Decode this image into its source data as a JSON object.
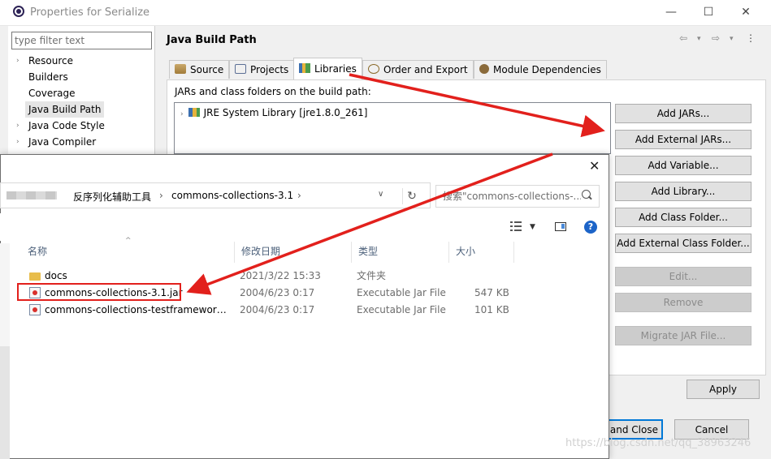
{
  "window": {
    "title": "Properties for Serialize",
    "minimize": "—",
    "maximize": "☐",
    "close": "✕"
  },
  "sidebar": {
    "filter_placeholder": "type filter text",
    "items": [
      {
        "label": "Resource",
        "arrow": "›"
      },
      {
        "label": "Builders",
        "arrow": ""
      },
      {
        "label": "Coverage",
        "arrow": ""
      },
      {
        "label": "Java Build Path",
        "arrow": ""
      },
      {
        "label": "Java Code Style",
        "arrow": "›"
      },
      {
        "label": "Java Compiler",
        "arrow": "›"
      }
    ]
  },
  "content": {
    "heading": "Java Build Path",
    "nav": {
      "back": "⇦",
      "back_drop": "▾",
      "fwd": "⇨",
      "fwd_drop": "▾",
      "menu": "⋮"
    },
    "tabs": [
      {
        "label": "Source"
      },
      {
        "label": "Projects"
      },
      {
        "label": "Libraries"
      },
      {
        "label": "Order and Export"
      },
      {
        "label": "Module Dependencies"
      }
    ],
    "panel_label": "JARs and class folders on the build path:",
    "library_entry": "JRE System Library [jre1.8.0_261]",
    "buttons": {
      "add_jars": "Add JARs...",
      "add_external_jars": "Add External JARs...",
      "add_variable": "Add Variable...",
      "add_library": "Add Library...",
      "add_class_folder": "Add Class Folder...",
      "add_external_class_folder": "Add External Class Folder...",
      "edit": "Edit...",
      "remove": "Remove",
      "migrate": "Migrate JAR File..."
    },
    "apply": "Apply",
    "apply_and_close": "and Close",
    "cancel": "Cancel"
  },
  "dialog": {
    "close": "✕",
    "breadcrumb": [
      "反序列化辅助工具",
      "commons-collections-3.1"
    ],
    "breadcrumb_sep": "›",
    "search_placeholder": "搜索\"commons-collections-...",
    "refresh": "↻",
    "columns": {
      "name": "名称",
      "modified": "修改日期",
      "type": "类型",
      "size": "大小"
    },
    "files": [
      {
        "name": "docs",
        "modified": "2021/3/22 15:33",
        "type": "文件夹",
        "size": "",
        "icon": "folder-icon"
      },
      {
        "name": "commons-collections-3.1.jar",
        "modified": "2004/6/23 0:17",
        "type": "Executable Jar File",
        "size": "547 KB",
        "icon": "jar-file-icon"
      },
      {
        "name": "commons-collections-testframework-...",
        "modified": "2004/6/23 0:17",
        "type": "Executable Jar File",
        "size": "101 KB",
        "icon": "jar-file-icon"
      }
    ],
    "help": "?"
  },
  "annotation_color": "#e2201c",
  "watermark": "https://blog.csdn.net/qq_38963246"
}
